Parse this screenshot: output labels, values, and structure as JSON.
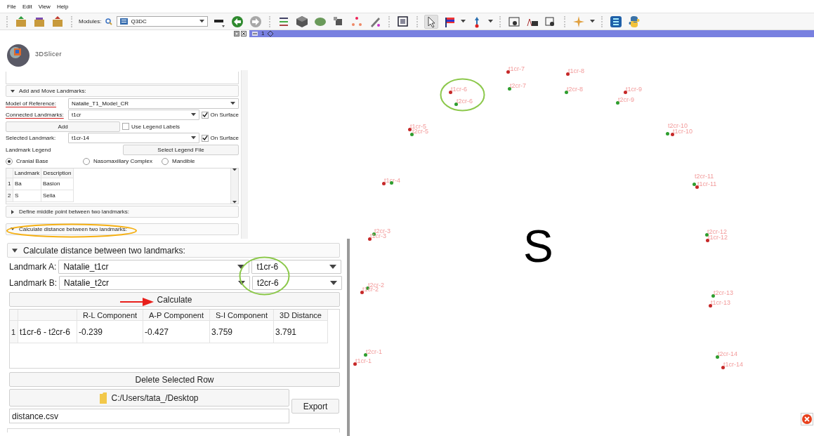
{
  "menu": [
    {
      "label": "File"
    },
    {
      "label": "Edit"
    },
    {
      "label": "View"
    },
    {
      "label": "Help"
    }
  ],
  "toolbar": {
    "modules_label": "Modules:",
    "module": "Q3DC"
  },
  "view_bar": {
    "label": "1"
  },
  "logo": {
    "text": "3DSlicer"
  },
  "add_move": {
    "title": "Add and Move Landmarks:",
    "expanded": true,
    "model_label": {
      "text": "Model of Reference:",
      "underlined": true
    },
    "model": "Natalie_T1_Model_CR",
    "connected_label": {
      "text": "Connected Landmarks:",
      "underlined": true
    },
    "connected": "t1cr",
    "connected_on_surface": {
      "label": "On Surface",
      "checked": true
    },
    "add_button": "Add",
    "use_legend": {
      "label": "Use Legend Labels",
      "checked": false
    },
    "selected_label": "Selected Landmark:",
    "selected": "t1cr-14",
    "selected_on_surface": {
      "label": "On Surface",
      "checked": true
    },
    "legend_label": "Landmark Legend",
    "legend_button": "Select Legend File",
    "regions": [
      {
        "label": "Cranial Base",
        "selected": true
      },
      {
        "label": "Nasomaxillary Complex",
        "selected": false
      },
      {
        "label": "Mandible",
        "selected": false
      }
    ],
    "legend_table": {
      "columns": [
        "Landmark",
        "Description"
      ],
      "rows": [
        {
          "index": "1",
          "cells": [
            "Ba",
            "Basion"
          ]
        },
        {
          "index": "2",
          "cells": [
            "S",
            "Sella"
          ]
        }
      ]
    }
  },
  "sections": [
    {
      "title": "Define middle point between two landmarks:",
      "expanded": false
    },
    {
      "title": "Calculate distance between two landmarks:",
      "expanded": true
    }
  ],
  "distance_panel": {
    "title": "Calculate distance between two landmarks:",
    "expanded": true,
    "landmark_a": {
      "label": "Landmark A:",
      "list": "Natalie_t1cr",
      "point": "t1cr-6"
    },
    "landmark_b": {
      "label": "Landmark B:",
      "list": "Natalie_t2cr",
      "point": "t2cr-6"
    },
    "calculate_button": "Calculate",
    "table": {
      "columns": [
        "R-L Component",
        "A-P Component",
        "S-I Component",
        "3D Distance"
      ],
      "rows": [
        {
          "index": "1",
          "name": "t1cr-6 - t2cr-6",
          "cells": [
            "-0.239",
            "-0.427",
            "3.759",
            "3.791"
          ]
        }
      ]
    },
    "delete_button": "Delete Selected Row",
    "folder_button": "C:/Users/tata_/Desktop",
    "export_button": "Export",
    "file_name": "distance.csv"
  },
  "viewer": {
    "orientation": "S",
    "landmarks": [
      {
        "label": "t1cr-7",
        "color": "#c62828"
      },
      {
        "label": "t1cr-8",
        "color": "#c62828"
      },
      {
        "label": "t1cr-6",
        "color": "#c62828"
      },
      {
        "label": "t2cr-7",
        "color": "#2e9e2e"
      },
      {
        "label": "t2cr-8",
        "color": "#2e9e2e"
      },
      {
        "label": "t1cr-9",
        "color": "#c62828"
      },
      {
        "label": "t2cr-6",
        "color": "#2e9e2e"
      },
      {
        "label": "t2cr-9",
        "color": "#2e9e2e"
      },
      {
        "label": "t1cr-5",
        "color": "#c62828"
      },
      {
        "label": "t2cr-5",
        "color": "#2e9e2e"
      },
      {
        "label": "t2cr-10",
        "color": "#2e9e2e"
      },
      {
        "label": "t1cr-10",
        "color": "#c62828"
      },
      {
        "label": "t1cr-4",
        "color": "#c62828"
      },
      {
        "color": "#2e9e2e"
      },
      {
        "label": "t2cr-11",
        "color": "#2e9e2e"
      },
      {
        "label": "t1cr-11",
        "color": "#c62828"
      },
      {
        "label": "t2cr-3",
        "color": "#2e9e2e"
      },
      {
        "label": "t1cr-3",
        "color": "#c62828"
      },
      {
        "label": "t2cr-12",
        "color": "#2e9e2e"
      },
      {
        "label": "t1cr-12",
        "color": "#c62828"
      },
      {
        "label": "t2cr-2",
        "color": "#2e9e2e"
      },
      {
        "label": "t1cr-2",
        "color": "#c62828"
      },
      {
        "label": "t2cr-13",
        "color": "#2e9e2e"
      },
      {
        "label": "t1cr-13",
        "color": "#c62828"
      },
      {
        "label": "t2cr-1",
        "color": "#2e9e2e"
      },
      {
        "label": "t2cr-14",
        "color": "#2e9e2e"
      },
      {
        "label": "t1cr-1",
        "color": "#c62828"
      },
      {
        "label": "t1cr-14",
        "color": "#c62828"
      }
    ]
  }
}
